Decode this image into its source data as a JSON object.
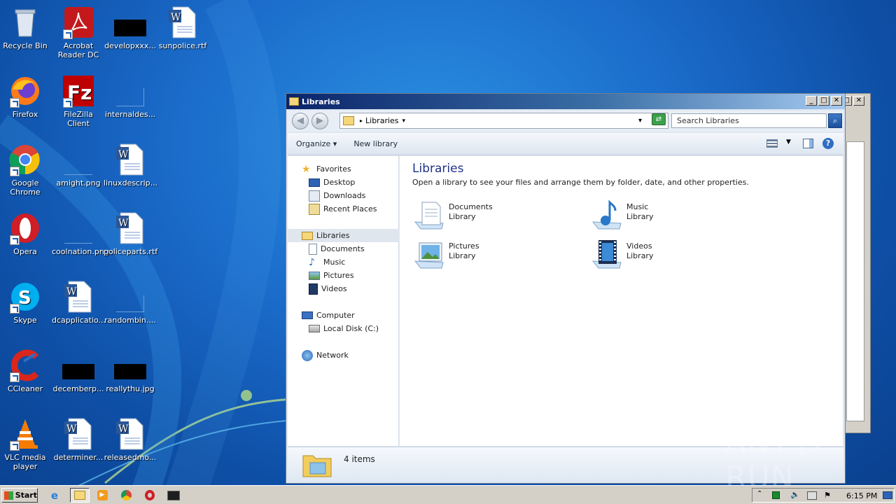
{
  "desktop": {
    "icons": [
      {
        "label": "Recycle Bin"
      },
      {
        "label": "Acrobat Reader DC"
      },
      {
        "label": "developxxx..."
      },
      {
        "label": "sunpolice.rtf"
      },
      {
        "label": "Firefox"
      },
      {
        "label": "FileZilla Client"
      },
      {
        "label": "internaldes..."
      },
      {
        "label": "Google Chrome"
      },
      {
        "label": "amight.png"
      },
      {
        "label": "linuxdescrip..."
      },
      {
        "label": "Opera"
      },
      {
        "label": "coolnation.png"
      },
      {
        "label": "policeparts.rtf"
      },
      {
        "label": "Skype"
      },
      {
        "label": "dcapplicatio..."
      },
      {
        "label": "randombin...."
      },
      {
        "label": "CCleaner"
      },
      {
        "label": "decemberp..."
      },
      {
        "label": "reallythu.jpg"
      },
      {
        "label": "VLC media player"
      },
      {
        "label": "determiner..."
      },
      {
        "label": "releasedmo..."
      }
    ]
  },
  "window": {
    "title": "Libraries",
    "minimize": "_",
    "maximize": "□",
    "close": "✕",
    "address": {
      "segment": "Libraries",
      "separator": "▸",
      "dropdown": "▾"
    },
    "search_placeholder": "Search Libraries",
    "toolbar": {
      "organize": "Organize",
      "new_library": "New library"
    },
    "nav": {
      "favorites": "Favorites",
      "desktop": "Desktop",
      "downloads": "Downloads",
      "recent_places": "Recent Places",
      "libraries": "Libraries",
      "documents": "Documents",
      "music": "Music",
      "pictures": "Pictures",
      "videos": "Videos",
      "computer": "Computer",
      "local_disk": "Local Disk (C:)",
      "network": "Network"
    },
    "content": {
      "heading": "Libraries",
      "description": "Open a library to see your files and arrange them by folder, date, and other properties.",
      "libraries": [
        {
          "name": "Documents",
          "type": "Library"
        },
        {
          "name": "Music",
          "type": "Library"
        },
        {
          "name": "Pictures",
          "type": "Library"
        },
        {
          "name": "Videos",
          "type": "Library"
        }
      ]
    },
    "status": {
      "item_count": "4 items"
    }
  },
  "taskbar": {
    "start_label": "Start",
    "clock": "6:15 PM"
  },
  "watermark": "ANY ▷ RUN"
}
